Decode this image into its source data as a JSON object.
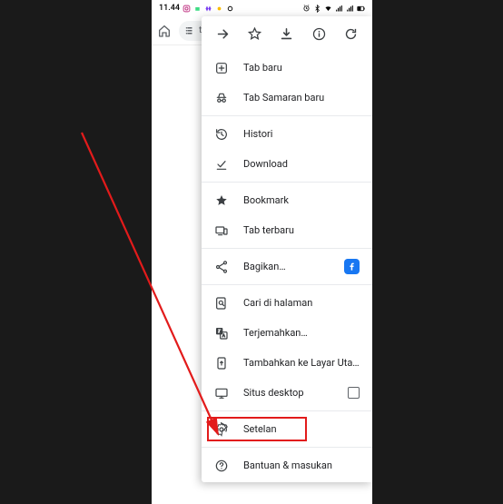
{
  "status": {
    "time": "11.44",
    "right_icons": [
      "alarm",
      "bluetooth",
      "wifi",
      "signal",
      "signal",
      "battery"
    ]
  },
  "omnibox": {
    "text": "tei"
  },
  "menu": {
    "items": [
      {
        "icon": "plus-box",
        "label": "Tab baru"
      },
      {
        "icon": "incognito",
        "label": "Tab Samaran baru"
      },
      {
        "sep": true
      },
      {
        "icon": "history",
        "label": "Histori"
      },
      {
        "icon": "download-done",
        "label": "Download"
      },
      {
        "sep": true
      },
      {
        "icon": "star-fill",
        "label": "Bookmark"
      },
      {
        "icon": "devices",
        "label": "Tab terbaru"
      },
      {
        "sep": true
      },
      {
        "icon": "share",
        "label": "Bagikan…",
        "trailing": "facebook"
      },
      {
        "sep": true
      },
      {
        "icon": "find",
        "label": "Cari di halaman"
      },
      {
        "icon": "translate",
        "label": "Terjemahkan…"
      },
      {
        "icon": "add-home",
        "label": "Tambahkan ke Layar Uta…"
      },
      {
        "icon": "desktop",
        "label": "Situs desktop",
        "trailing": "checkbox"
      },
      {
        "sep": true
      },
      {
        "icon": "gear",
        "label": "Setelan",
        "highlight": true
      },
      {
        "sep": true
      },
      {
        "icon": "help",
        "label": "Bantuan & masukan"
      }
    ]
  }
}
